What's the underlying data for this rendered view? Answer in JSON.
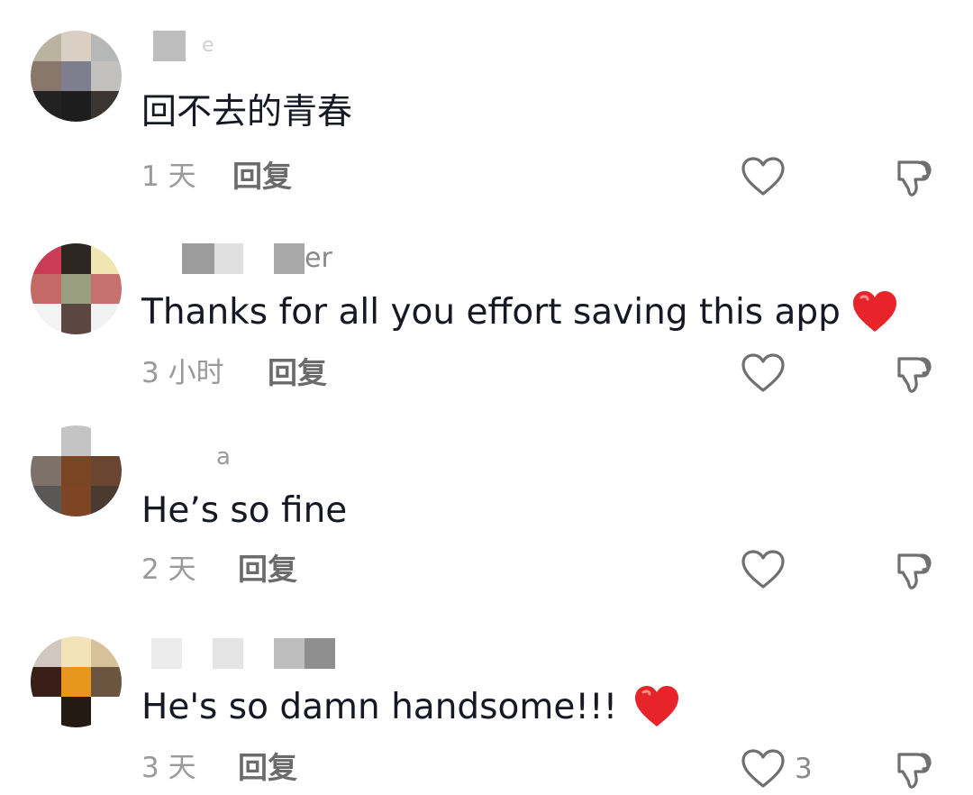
{
  "comments": [
    {
      "username_tail": "e",
      "text": "回不去的青春",
      "time": "1 天",
      "reply_label": "回复",
      "like_count": "",
      "avatar_colors": [
        "#b9b39f",
        "#d9cfc2",
        "#b5b8b6",
        "#8a776c",
        "#7d7f8f",
        "#c2c0bd",
        "#222222",
        "#1d1d1d",
        "#3a3530"
      ]
    },
    {
      "username_tail": "er",
      "text": "Thanks for all you effort saving this app",
      "time": "3 小时",
      "reply_label": "回复",
      "like_count": "",
      "avatar_colors": [
        "#cc3b55",
        "#2d2620",
        "#efe6b4",
        "#c46a66",
        "#9a9f82",
        "#c77070",
        "#f3f3f3",
        "#5c4740",
        "#f2f2f2"
      ]
    },
    {
      "username_tail": "a",
      "text": "He’s so fine",
      "time": "2 天",
      "reply_label": "回复",
      "like_count": "",
      "avatar_colors": [
        "#ffffff",
        "#c4c4c4",
        "#ffffff",
        "#7e716a",
        "#7a4523",
        "#6a4632",
        "#5a5757",
        "#7d4524",
        "#4b3a2f"
      ]
    },
    {
      "username_tail": "",
      "text": "He's so damn handsome!!!",
      "time": "3 天",
      "reply_label": "回复",
      "like_count": "3",
      "avatar_colors": [
        "#cfc7c0",
        "#f3e3b8",
        "#d6c198",
        "#3a1f18",
        "#e8961e",
        "#6b5540",
        "#ffffff",
        "#231a14",
        "#ffffff"
      ]
    }
  ],
  "colors": {
    "text": "#161823",
    "meta": "#9a9a9a",
    "reply": "#6b6b6b",
    "icon": "#6f6f6f",
    "heart_emoji": "#e8242b"
  },
  "icons": {
    "like": "heart-outline-icon",
    "dislike": "thumbs-down-icon",
    "emoji": "red-heart-emoji"
  }
}
